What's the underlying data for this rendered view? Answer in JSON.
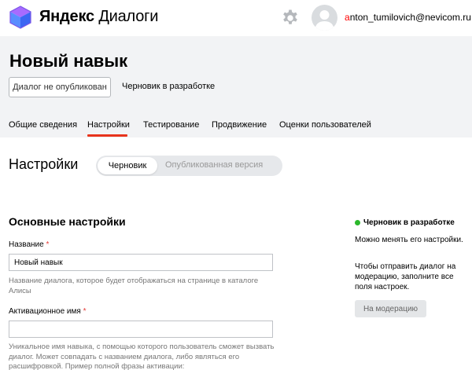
{
  "header": {
    "brand_bold": "Яндекс",
    "brand_light": "Диалоги",
    "user_email_first": "a",
    "user_email_rest": "nton_tumilovich@nevicom.ru"
  },
  "skill": {
    "title": "Новый навык",
    "status_button": "Диалог не опубликован",
    "status_text": "Черновик в разработке"
  },
  "tabs": [
    {
      "label": "Общие сведения"
    },
    {
      "label": "Настройки"
    },
    {
      "label": "Тестирование"
    },
    {
      "label": "Продвижение"
    },
    {
      "label": "Оценки пользователей"
    }
  ],
  "settings": {
    "title": "Настройки",
    "segment_draft": "Черновик",
    "segment_published": "Опубликованная версия"
  },
  "form": {
    "section_title": "Основные настройки",
    "name_label": "Название",
    "name_value": "Новый навык",
    "name_hint": "Название диалога, которое будет отображаться на странице в каталоге Алисы",
    "activation_label": "Активационное имя",
    "activation_value": "",
    "activation_hint": "Уникальное имя навыка, с помощью которого пользователь сможет вызвать диалог. Может совпадать с названием диалога, либо являться его расшифровкой. Пример полной фразы активации:",
    "required_mark": "*"
  },
  "side_panel": {
    "status": "Черновик в разработке",
    "note1": "Можно менять его настройки.",
    "note2": "Чтобы отправить диалог на модерацию, заполните все поля настроек.",
    "moderation_button": "На модерацию"
  },
  "colors": {
    "accent": "#e8341c",
    "status_dot": "#2bb82b",
    "banner_bg": "#f2f3f5"
  },
  "icons": {
    "logo": "dialogs-cube-logo",
    "settings": "gear-icon",
    "avatar": "user-avatar"
  }
}
